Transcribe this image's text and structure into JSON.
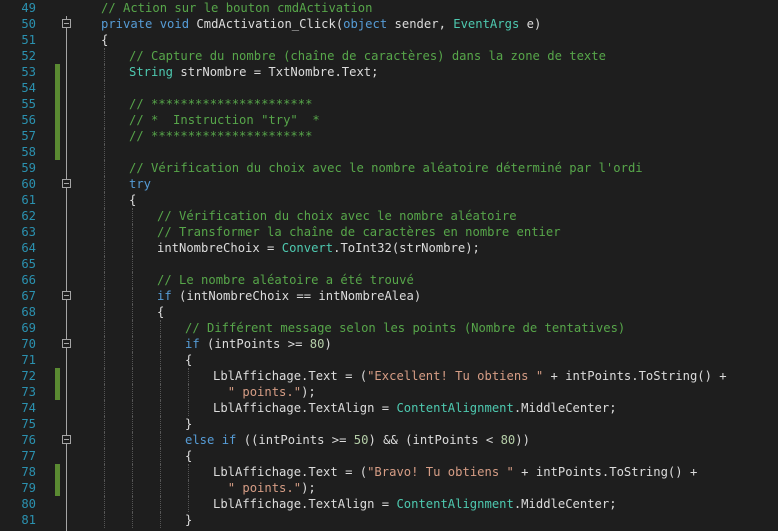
{
  "editor": {
    "colors": {
      "background": "#1e1e1e",
      "line_number": "#2b91af",
      "keyword": "#569cd6",
      "type": "#4ec9b0",
      "comment": "#57a64a",
      "string": "#d69d85",
      "number": "#b5cea8",
      "plain": "#dcdcdc",
      "change_marker": "#5a8a32"
    },
    "lines": [
      {
        "num": "49",
        "indent": 2,
        "marker": false,
        "fold": false,
        "tokens": [
          {
            "t": "// Action sur le bouton cmdActivation",
            "c": "cm"
          }
        ]
      },
      {
        "num": "50",
        "indent": 2,
        "marker": false,
        "fold": true,
        "tokens": [
          {
            "t": "private",
            "c": "kw"
          },
          {
            "t": " ",
            "c": "pl"
          },
          {
            "t": "void",
            "c": "kw"
          },
          {
            "t": " CmdActivation_Click(",
            "c": "pl"
          },
          {
            "t": "object",
            "c": "kw"
          },
          {
            "t": " sender, ",
            "c": "pl"
          },
          {
            "t": "EventArgs",
            "c": "ty"
          },
          {
            "t": " e)",
            "c": "pl"
          }
        ]
      },
      {
        "num": "51",
        "indent": 2,
        "marker": false,
        "fold": false,
        "tokens": [
          {
            "t": "{",
            "c": "pl"
          }
        ]
      },
      {
        "num": "52",
        "indent": 3,
        "marker": false,
        "fold": false,
        "tokens": [
          {
            "t": "// Capture du nombre (chaîne de caractères) dans la zone de texte",
            "c": "cm"
          }
        ]
      },
      {
        "num": "53",
        "indent": 3,
        "marker": true,
        "fold": false,
        "tokens": [
          {
            "t": "String",
            "c": "ty"
          },
          {
            "t": " strNombre = TxtNombre.Text;",
            "c": "pl"
          }
        ]
      },
      {
        "num": "54",
        "indent": 3,
        "marker": true,
        "fold": false,
        "tokens": []
      },
      {
        "num": "55",
        "indent": 3,
        "marker": true,
        "fold": false,
        "tokens": [
          {
            "t": "// **********************",
            "c": "cm"
          }
        ]
      },
      {
        "num": "56",
        "indent": 3,
        "marker": true,
        "fold": false,
        "tokens": [
          {
            "t": "// *  Instruction \"try\"  *",
            "c": "cm"
          }
        ]
      },
      {
        "num": "57",
        "indent": 3,
        "marker": true,
        "fold": false,
        "tokens": [
          {
            "t": "// **********************",
            "c": "cm"
          }
        ]
      },
      {
        "num": "58",
        "indent": 3,
        "marker": true,
        "fold": false,
        "tokens": []
      },
      {
        "num": "59",
        "indent": 3,
        "marker": false,
        "fold": false,
        "tokens": [
          {
            "t": "// Vérification du choix avec le nombre aléatoire déterminé par l'ordi",
            "c": "cm"
          }
        ]
      },
      {
        "num": "60",
        "indent": 3,
        "marker": false,
        "fold": true,
        "tokens": [
          {
            "t": "try",
            "c": "kw"
          }
        ]
      },
      {
        "num": "61",
        "indent": 3,
        "marker": false,
        "fold": false,
        "tokens": [
          {
            "t": "{",
            "c": "pl"
          }
        ]
      },
      {
        "num": "62",
        "indent": 4,
        "marker": false,
        "fold": false,
        "tokens": [
          {
            "t": "// Vérification du choix avec le nombre aléatoire",
            "c": "cm"
          }
        ]
      },
      {
        "num": "63",
        "indent": 4,
        "marker": false,
        "fold": false,
        "tokens": [
          {
            "t": "// Transformer la chaîne de caractères en nombre entier",
            "c": "cm"
          }
        ]
      },
      {
        "num": "64",
        "indent": 4,
        "marker": false,
        "fold": false,
        "tokens": [
          {
            "t": "intNombreChoix = ",
            "c": "pl"
          },
          {
            "t": "Convert",
            "c": "ty"
          },
          {
            "t": ".ToInt32(strNombre);",
            "c": "pl"
          }
        ]
      },
      {
        "num": "65",
        "indent": 4,
        "marker": false,
        "fold": false,
        "tokens": []
      },
      {
        "num": "66",
        "indent": 4,
        "marker": false,
        "fold": false,
        "tokens": [
          {
            "t": "// Le nombre aléatoire a été trouvé",
            "c": "cm"
          }
        ]
      },
      {
        "num": "67",
        "indent": 4,
        "marker": false,
        "fold": true,
        "tokens": [
          {
            "t": "if",
            "c": "kw"
          },
          {
            "t": " (intNombreChoix == intNombreAlea)",
            "c": "pl"
          }
        ]
      },
      {
        "num": "68",
        "indent": 4,
        "marker": false,
        "fold": false,
        "tokens": [
          {
            "t": "{",
            "c": "pl"
          }
        ]
      },
      {
        "num": "69",
        "indent": 5,
        "marker": false,
        "fold": false,
        "tokens": [
          {
            "t": "// Différent message selon les points (Nombre de tentatives)",
            "c": "cm"
          }
        ]
      },
      {
        "num": "70",
        "indent": 5,
        "marker": false,
        "fold": true,
        "tokens": [
          {
            "t": "if",
            "c": "kw"
          },
          {
            "t": " (intPoints >= ",
            "c": "pl"
          },
          {
            "t": "80",
            "c": "nu"
          },
          {
            "t": ")",
            "c": "pl"
          }
        ]
      },
      {
        "num": "71",
        "indent": 5,
        "marker": false,
        "fold": false,
        "tokens": [
          {
            "t": "{",
            "c": "pl"
          }
        ]
      },
      {
        "num": "72",
        "indent": 6,
        "marker": true,
        "fold": false,
        "tokens": [
          {
            "t": "LblAffichage.Text = (",
            "c": "pl"
          },
          {
            "t": "\"Excellent! Tu obtiens \"",
            "c": "st"
          },
          {
            "t": " + intPoints.ToString() +",
            "c": "pl"
          }
        ]
      },
      {
        "num": "73",
        "indent": 6,
        "marker": true,
        "fold": false,
        "tokens": [
          {
            "t": "  ",
            "c": "pl"
          },
          {
            "t": "\" points.\"",
            "c": "st"
          },
          {
            "t": ");",
            "c": "pl"
          }
        ]
      },
      {
        "num": "74",
        "indent": 6,
        "marker": false,
        "fold": false,
        "tokens": [
          {
            "t": "LblAffichage.TextAlign = ",
            "c": "pl"
          },
          {
            "t": "ContentAlignment",
            "c": "ty"
          },
          {
            "t": ".MiddleCenter;",
            "c": "pl"
          }
        ]
      },
      {
        "num": "75",
        "indent": 5,
        "marker": false,
        "fold": false,
        "tokens": [
          {
            "t": "}",
            "c": "pl"
          }
        ]
      },
      {
        "num": "76",
        "indent": 5,
        "marker": false,
        "fold": true,
        "tokens": [
          {
            "t": "else",
            "c": "kw"
          },
          {
            "t": " ",
            "c": "pl"
          },
          {
            "t": "if",
            "c": "kw"
          },
          {
            "t": " ((intPoints >= ",
            "c": "pl"
          },
          {
            "t": "50",
            "c": "nu"
          },
          {
            "t": ") && (intPoints < ",
            "c": "pl"
          },
          {
            "t": "80",
            "c": "nu"
          },
          {
            "t": "))",
            "c": "pl"
          }
        ]
      },
      {
        "num": "77",
        "indent": 5,
        "marker": false,
        "fold": false,
        "tokens": [
          {
            "t": "{",
            "c": "pl"
          }
        ]
      },
      {
        "num": "78",
        "indent": 6,
        "marker": true,
        "fold": false,
        "tokens": [
          {
            "t": "LblAffichage.Text = (",
            "c": "pl"
          },
          {
            "t": "\"Bravo! Tu obtiens \"",
            "c": "st"
          },
          {
            "t": " + intPoints.ToString() +",
            "c": "pl"
          }
        ]
      },
      {
        "num": "79",
        "indent": 6,
        "marker": true,
        "fold": false,
        "tokens": [
          {
            "t": "  ",
            "c": "pl"
          },
          {
            "t": "\" points.\"",
            "c": "st"
          },
          {
            "t": ");",
            "c": "pl"
          }
        ]
      },
      {
        "num": "80",
        "indent": 6,
        "marker": false,
        "fold": false,
        "tokens": [
          {
            "t": "LblAffichage.TextAlign = ",
            "c": "pl"
          },
          {
            "t": "ContentAlignment",
            "c": "ty"
          },
          {
            "t": ".MiddleCenter;",
            "c": "pl"
          }
        ]
      },
      {
        "num": "81",
        "indent": 5,
        "marker": false,
        "fold": false,
        "tokens": [
          {
            "t": "}",
            "c": "pl"
          }
        ]
      }
    ]
  }
}
